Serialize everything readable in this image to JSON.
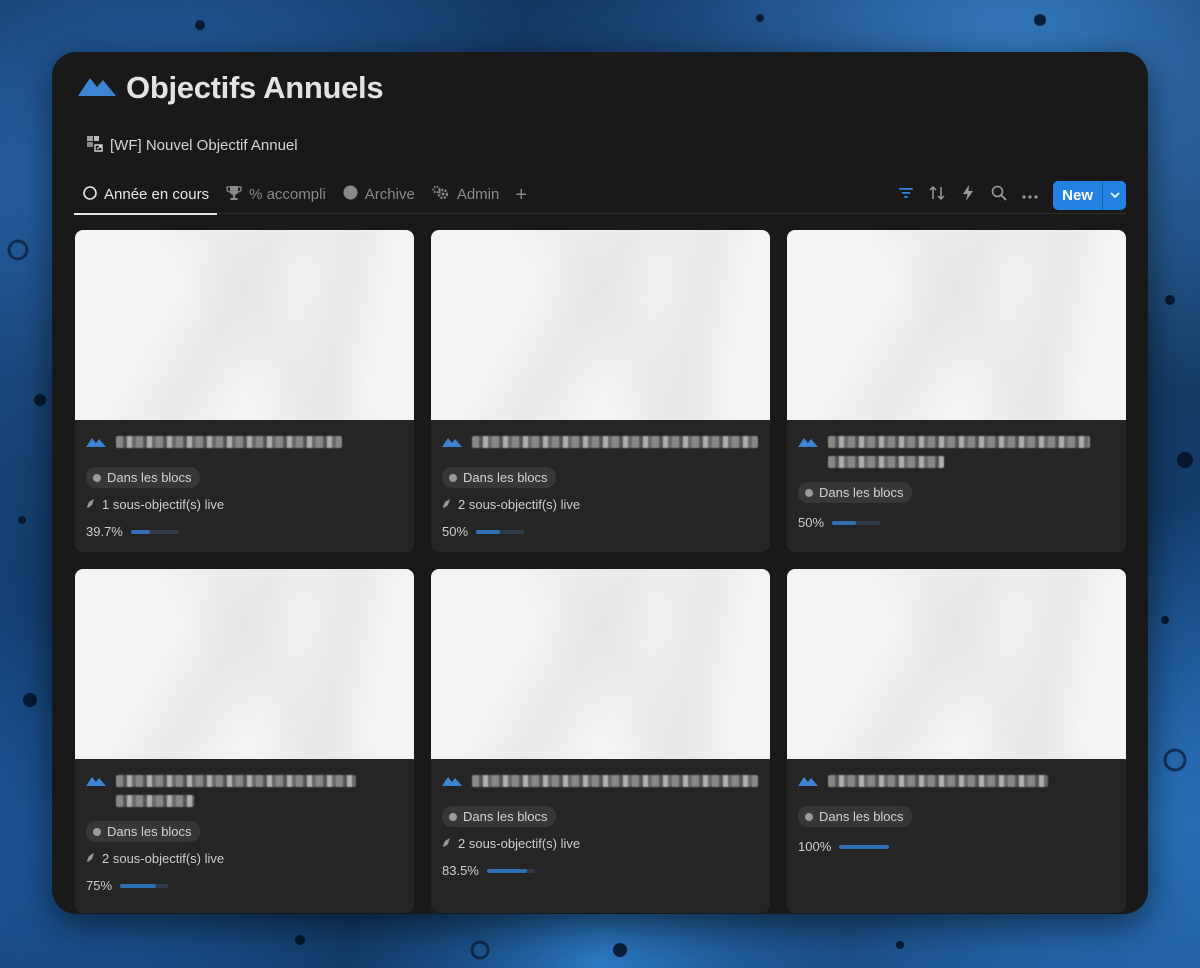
{
  "page": {
    "title": "Objectifs Annuels",
    "title_icon": "mountain-icon",
    "template_link": "[WF] Nouvel Objectif Annuel"
  },
  "tabs": [
    {
      "label": "Année en cours",
      "icon": "circle-outline-icon",
      "active": true
    },
    {
      "label": "% accompli",
      "icon": "trophy-icon",
      "active": false
    },
    {
      "label": "Archive",
      "icon": "circle-filled-icon",
      "active": false
    },
    {
      "label": "Admin",
      "icon": "gears-icon",
      "active": false
    }
  ],
  "toolbar": {
    "new_label": "New",
    "icons": [
      "filter-icon",
      "sort-icon",
      "lightning-icon",
      "search-icon",
      "more-icon"
    ]
  },
  "colors": {
    "accent": "#2383e2",
    "progress": "#2f6fb5",
    "window_bg": "#191919",
    "card_bg": "#252525"
  },
  "cards": [
    {
      "tag": "Dans les blocs",
      "sub": "1 sous-objectif(s) live",
      "progress_label": "39.7%",
      "progress": 0.397
    },
    {
      "tag": "Dans les blocs",
      "sub": "2 sous-objectif(s) live",
      "progress_label": "50%",
      "progress": 0.5
    },
    {
      "tag": "Dans les blocs",
      "sub": "",
      "progress_label": "50%",
      "progress": 0.5
    },
    {
      "tag": "Dans les blocs",
      "sub": "2 sous-objectif(s) live",
      "progress_label": "75%",
      "progress": 0.75
    },
    {
      "tag": "Dans les blocs",
      "sub": "2 sous-objectif(s) live",
      "progress_label": "83.5%",
      "progress": 0.835
    },
    {
      "tag": "Dans les blocs",
      "sub": "",
      "progress_label": "100%",
      "progress": 1.0
    }
  ]
}
